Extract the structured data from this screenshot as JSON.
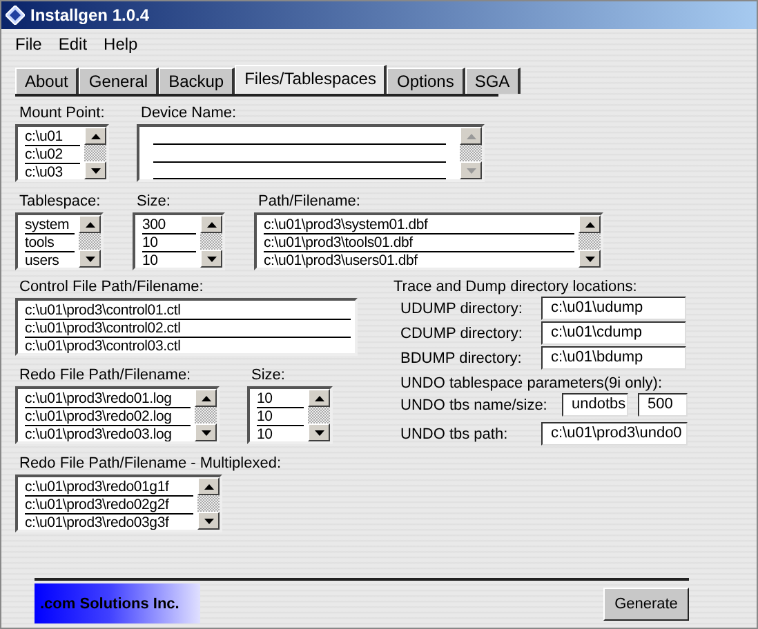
{
  "window": {
    "title": "Installgen 1.0.4"
  },
  "menu": [
    "File",
    "Edit",
    "Help"
  ],
  "tabs": [
    {
      "label": "About",
      "selected": false
    },
    {
      "label": "General",
      "selected": false
    },
    {
      "label": "Backup",
      "selected": false
    },
    {
      "label": "Files/Tablespaces",
      "selected": true
    },
    {
      "label": "Options",
      "selected": false
    },
    {
      "label": "SGA",
      "selected": false
    }
  ],
  "mount_point": {
    "label": "Mount Point:",
    "items": [
      "c:\\u01",
      "c:\\u02",
      "c:\\u03"
    ]
  },
  "device_name": {
    "label": "Device Name:",
    "disabled": true
  },
  "tablespace": {
    "label": "Tablespace:",
    "items": [
      "system",
      "tools",
      "users"
    ]
  },
  "tablespace_size": {
    "label": "Size:",
    "items": [
      "300",
      "10",
      "10"
    ]
  },
  "tablespace_path": {
    "label": "Path/Filename:",
    "items": [
      "c:\\u01\\prod3\\system01.dbf",
      "c:\\u01\\prod3\\tools01.dbf",
      "c:\\u01\\prod3\\users01.dbf"
    ]
  },
  "control_files": {
    "label": "Control File Path/Filename:",
    "items": [
      "c:\\u01\\prod3\\control01.ctl",
      "c:\\u01\\prod3\\control02.ctl",
      "c:\\u01\\prod3\\control03.ctl"
    ]
  },
  "trace": {
    "heading": "Trace and Dump directory locations:",
    "rows": [
      {
        "label": "UDUMP directory:",
        "value": "c:\\u01\\udump"
      },
      {
        "label": "CDUMP directory:",
        "value": "c:\\u01\\cdump"
      },
      {
        "label": "BDUMP directory:",
        "value": "c:\\u01\\bdump"
      }
    ]
  },
  "undo": {
    "heading": "UNDO tablespace parameters(9i only):",
    "name_label": "UNDO tbs name/size:",
    "name": "undotbs",
    "size": "500",
    "path_label": "UNDO tbs path:",
    "path": "c:\\u01\\prod3\\undo0"
  },
  "redo_files": {
    "label": "Redo File Path/Filename:",
    "items": [
      "c:\\u01\\prod3\\redo01.log",
      "c:\\u01\\prod3\\redo02.log",
      "c:\\u01\\prod3\\redo03.log"
    ]
  },
  "redo_size": {
    "label": "Size:",
    "items": [
      "10",
      "10",
      "10"
    ]
  },
  "redo_multiplexed": {
    "label": "Redo File Path/Filename - Multiplexed:",
    "items": [
      "c:\\u01\\prod3\\redo01g1f",
      "c:\\u01\\prod3\\redo02g2f",
      "c:\\u01\\prod3\\redo03g3f"
    ]
  },
  "logo": ".com Solutions Inc.",
  "buttons": [
    "Generate"
  ]
}
